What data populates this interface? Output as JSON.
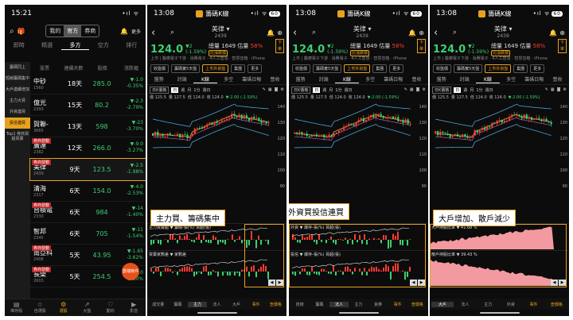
{
  "status": {
    "time1": "15:21",
    "time2": "13:08",
    "time3": "13:08",
    "time4": "13:08",
    "app": "籌碼K線",
    "signal": "•ıl ᯤ",
    "battery": "60"
  },
  "list": {
    "tab_mine": "我的",
    "tab_official": "官方",
    "tab_broker": "券商",
    "more": "更多",
    "cats": [
      "即時",
      "精選",
      "多方",
      "空方",
      "排行"
    ],
    "left": [
      "籌碼同上",
      "短線籌碼集中",
      "大戶連續增加",
      "主力大買",
      "外資連買",
      "投信連買",
      "Top1 券商買超買賣"
    ],
    "headers": [
      "股票",
      "連續天數",
      "股價",
      "漲跌幅"
    ],
    "rows": [
      {
        "tag": "",
        "name": "中砂",
        "code": "1560",
        "days": "18天",
        "price": "285.0",
        "chg": "▼-1.0",
        "pct": "-0.35%"
      },
      {
        "tag": "",
        "name": "億光",
        "code": "2393",
        "days": "15天",
        "price": "80.2",
        "chg": "▼-2.3",
        "pct": "-2.79%"
      },
      {
        "tag": "",
        "name": "賀聯-",
        "code": "3665",
        "days": "13天",
        "price": "598",
        "chg": "▼-23",
        "pct": "-3.70%"
      },
      {
        "tag": "券商發動",
        "name": "廣達",
        "code": "2382",
        "days": "12天",
        "price": "266.0",
        "chg": "▼-9.0",
        "pct": "-3.27%"
      },
      {
        "tag": "券商發動",
        "name": "美律",
        "code": "2439",
        "days": "9天",
        "price": "123.5",
        "chg": "▼-2.5",
        "pct": "-1.98%"
      },
      {
        "tag": "",
        "name": "清海",
        "code": "2317",
        "days": "6天",
        "price": "154.0",
        "chg": "▼-4.0",
        "pct": "-2.53%"
      },
      {
        "tag": "券商發動",
        "name": "台積電",
        "code": "2330",
        "days": "6天",
        "price": "984",
        "chg": "▼-14",
        "pct": "-1.40%"
      },
      {
        "tag": "",
        "name": "智邦",
        "code": "2345",
        "days": "6天",
        "price": "705",
        "chg": "▼-11",
        "pct": "-1.54%"
      },
      {
        "tag": "券商發動",
        "name": "南亞科",
        "code": "2408",
        "days": "5天",
        "price": "43.95",
        "chg": "▼-1.65",
        "pct": "-3.62%"
      },
      {
        "tag": "券商發動",
        "name": "長榮",
        "code": "2603",
        "days": "5天",
        "price": "254.5",
        "chg": "▼-6.0",
        "pct": "-2.30%"
      }
    ],
    "fab": "雲端條件",
    "nav": [
      "庫存股",
      "自選股",
      "選股",
      "大盤",
      "動向",
      "影音"
    ]
  },
  "stock": {
    "name": "美律",
    "code": "2439",
    "price": "124.0",
    "chg": "▼2",
    "pct": "(-1.59%)",
    "vol": "總量 1649",
    "est": "估量",
    "estv": "58%",
    "badge": "比漲跌價",
    "tagline": "上市 | 醫療電子下游 · 消費電子 · 4人工智慧 · 智慧音箱 · iPhone",
    "chips": [
      "收盤價",
      "籌碼實5天盤",
      "上市外資盤",
      "集團",
      "更多"
    ],
    "tabs": [
      "盤勢",
      "討論",
      "K線",
      "多空",
      "籌碼日報",
      "營收"
    ],
    "tb": [
      "日K價格",
      "日",
      "週",
      "月",
      "1分",
      "週日"
    ],
    "ma": [
      "價 125.5",
      "量 127.5",
      "低 124.0",
      "收 124.0",
      "▼-2.00 (-1.59%)"
    ],
    "yt": [
      "140",
      "130",
      "120",
      "110",
      "100",
      "90"
    ],
    "sub2": [
      "主力買賣超 ▼",
      "籌碼-張(%)",
      "買超(張)"
    ],
    "sub2b": [
      "買賣家數差 ▼",
      "家數差"
    ],
    "sub3": [
      "外資 ▼",
      "爆存-張(%)",
      "買超(張)"
    ],
    "sub3b": [
      "投信 ▼",
      "爆存-張(%)",
      "買超(張)"
    ],
    "sub4": [
      "大戶持股比率 ▼",
      "41.68 %"
    ],
    "sub4b": [
      "散戶持股比率 ▼",
      "39.43 %"
    ],
    "ntab": [
      "成交量",
      "籌碼",
      "主力",
      "法人",
      "大戶",
      "事件",
      "查價格"
    ],
    "ntab3": [
      "技術",
      "籌碼",
      "法人",
      "主力",
      "資券",
      "事件",
      "查價格"
    ],
    "ntab4": [
      "大戶",
      "法人",
      "主力",
      "外資",
      "事件",
      "查價格"
    ]
  },
  "captions": {
    "c2": "主力買、籌碼集中",
    "c3": "外資買投信連買",
    "c4": "大戶增加、散戶減少"
  },
  "inset": "下單"
}
